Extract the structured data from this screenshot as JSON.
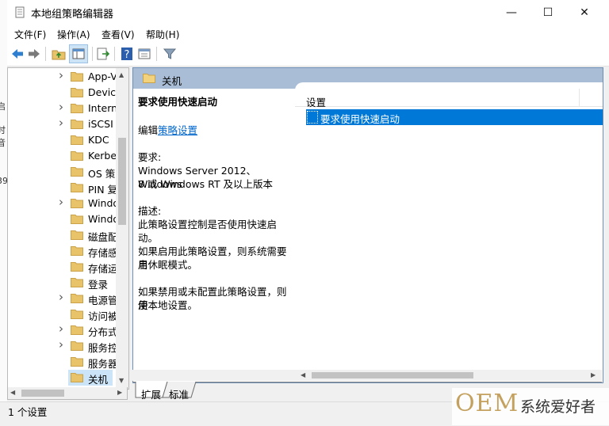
{
  "window": {
    "title": "本地组策略编辑器"
  },
  "title_controls": {
    "minimize": "—",
    "maximize": "☐",
    "close": "✕"
  },
  "menu": [
    "文件(F)",
    "操作(A)",
    "查看(V)",
    "帮助(H)"
  ],
  "background_window_fragments": [
    "启",
    "时",
    "音",
    "39"
  ],
  "toolbar": {
    "icons": [
      "back-arrow-icon",
      "forward-arrow-icon",
      "up-folder-icon",
      "show-hide-tree-icon",
      "export-list-icon",
      "help-icon",
      "properties-icon",
      "filter-icon"
    ]
  },
  "tree": {
    "items": [
      {
        "label": "App-V",
        "expandable": true
      },
      {
        "label": "Device",
        "expandable": false
      },
      {
        "label": "Intern",
        "expandable": true
      },
      {
        "label": "iSCSI",
        "expandable": true
      },
      {
        "label": "KDC",
        "expandable": false
      },
      {
        "label": "Kerbe",
        "expandable": false
      },
      {
        "label": "OS 策略",
        "expandable": false
      },
      {
        "label": "PIN 复",
        "expandable": false
      },
      {
        "label": "Windo",
        "expandable": true
      },
      {
        "label": "Windo",
        "expandable": false
      },
      {
        "label": "磁盘配",
        "expandable": false
      },
      {
        "label": "存储感",
        "expandable": false
      },
      {
        "label": "存储运",
        "expandable": false
      },
      {
        "label": "登录",
        "expandable": false
      },
      {
        "label": "电源管",
        "expandable": true
      },
      {
        "label": "访问被",
        "expandable": false
      },
      {
        "label": "分布式",
        "expandable": true
      },
      {
        "label": "服务控",
        "expandable": true
      },
      {
        "label": "服务器",
        "expandable": false
      },
      {
        "label": "关机",
        "expandable": false,
        "selected": true
      }
    ]
  },
  "pane": {
    "header": "关机",
    "policy_title": "要求使用快速启动",
    "edit_prefix": "编辑",
    "edit_link": "策略设置",
    "requirements_label": "要求:",
    "requirements_line1": "Windows Server 2012、Windows",
    "requirements_line2": "8 或 Windows RT 及以上版本",
    "description_label": "描述:",
    "description_text": "此策略设置控制是否使用快速启动。",
    "enable_line1": "如果启用此策略设置，则系统需要启",
    "enable_line2": "用休眠模式。",
    "disable_line1": "如果禁用或未配置此策略设置，则使",
    "disable_line2": "用本地设置。"
  },
  "list": {
    "column_header": "设置",
    "rows": [
      "要求使用快速启动"
    ]
  },
  "tabs": [
    "扩展",
    "标准"
  ],
  "status": "1 个设置",
  "watermark": {
    "oem": "OEM",
    "text": "系统爱好者"
  },
  "colors": {
    "selection": "#0078d7",
    "pane_header": "#a9bed6",
    "link": "#0066cc",
    "folder": "#e8c36a"
  }
}
